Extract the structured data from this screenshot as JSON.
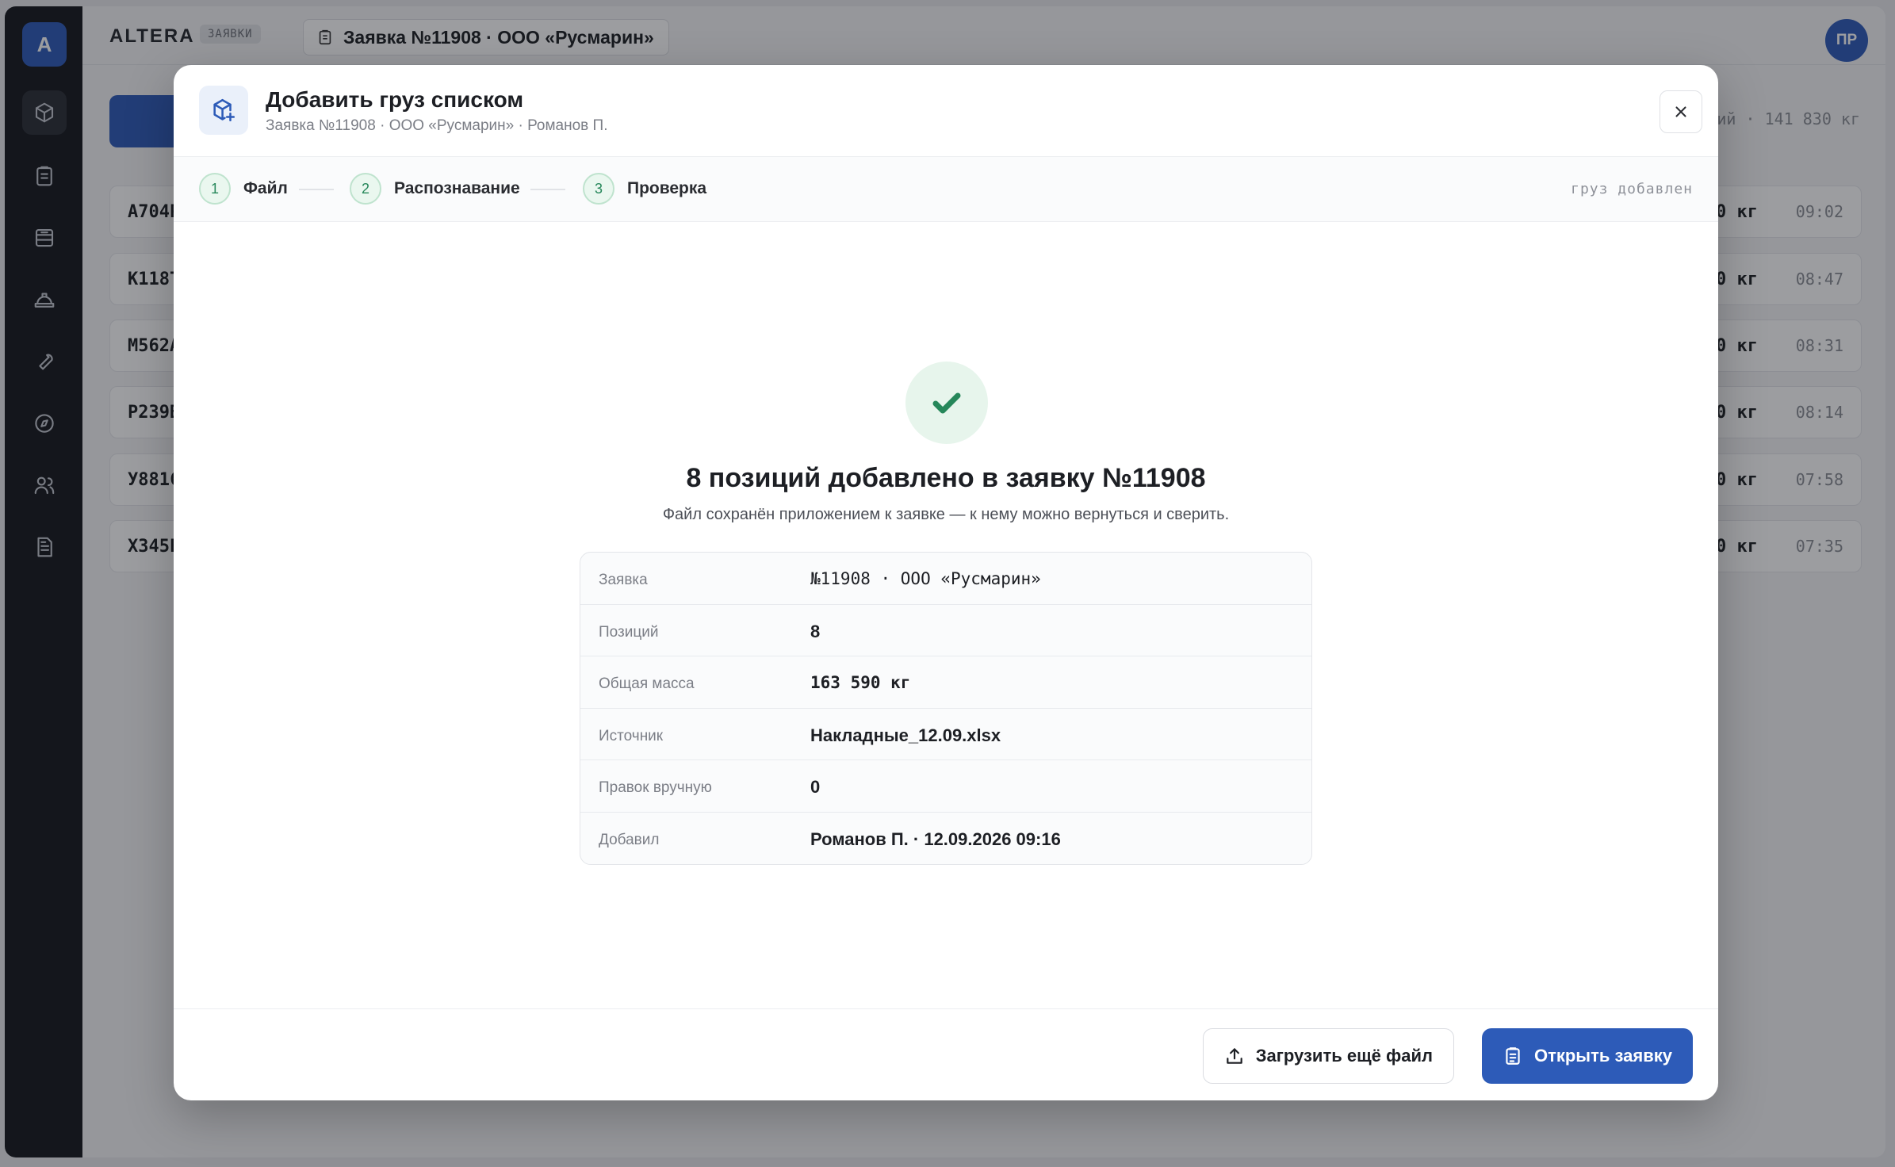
{
  "app": {
    "logo_letter": "A",
    "brand": "ALTERA",
    "section_tag": "ЗАЯВКИ",
    "breadcrumb": "Заявка №11908 · ООО «Русмарин»",
    "avatar_initials": "ПР",
    "colors": {
      "accent": "#2d5bb8",
      "success": "#26875a",
      "sidebar": "#16181d"
    }
  },
  "sidebar": {
    "items": [
      {
        "icon": "cube-icon",
        "active": true
      },
      {
        "icon": "clipboard-icon",
        "active": false
      },
      {
        "icon": "archive-icon",
        "active": false
      },
      {
        "icon": "hardhat-icon",
        "active": false
      },
      {
        "icon": "wrench-icon",
        "active": false
      },
      {
        "icon": "compass-icon",
        "active": false
      },
      {
        "icon": "users-icon",
        "active": false
      },
      {
        "icon": "document-icon",
        "active": false
      }
    ]
  },
  "background": {
    "summary": "ий · 141 830 кг",
    "rows": [
      {
        "code": "А704Р",
        "mass": "0 кг",
        "time": "09:02"
      },
      {
        "code": "К118Т",
        "mass": "0 кг",
        "time": "08:47"
      },
      {
        "code": "М562А",
        "mass": "0 кг",
        "time": "08:31"
      },
      {
        "code": "Р239В",
        "mass": "0 кг",
        "time": "08:14"
      },
      {
        "code": "У881С",
        "mass": "0 кг",
        "time": "07:58"
      },
      {
        "code": "Х345Е",
        "mass": "0 кг",
        "time": "07:35"
      }
    ]
  },
  "modal": {
    "title": "Добавить груз списком",
    "subtitle": "Заявка №11908 · ООО «Русмарин» · Романов П.",
    "steps": [
      {
        "num": "1",
        "label": "Файл"
      },
      {
        "num": "2",
        "label": "Распознавание"
      },
      {
        "num": "3",
        "label": "Проверка"
      }
    ],
    "status": "груз добавлен",
    "success_title": "8 позиций добавлено в заявку №11908",
    "success_subtitle": "Файл сохранён приложением к заявке — к нему можно вернуться и сверить.",
    "info": [
      {
        "label": "Заявка",
        "value": "№11908 · ООО «Русмарин»"
      },
      {
        "label": "Позиций",
        "value": "8"
      },
      {
        "label": "Общая масса",
        "value": "163 590 кг"
      },
      {
        "label": "Источник",
        "value": "Накладные_12.09.xlsx"
      },
      {
        "label": "Правок вручную",
        "value": "0"
      },
      {
        "label": "Добавил",
        "value": "Романов П. · 12.09.2026 09:16"
      }
    ],
    "buttons": {
      "upload_more": "Загрузить ещё файл",
      "open_request": "Открыть заявку"
    }
  }
}
